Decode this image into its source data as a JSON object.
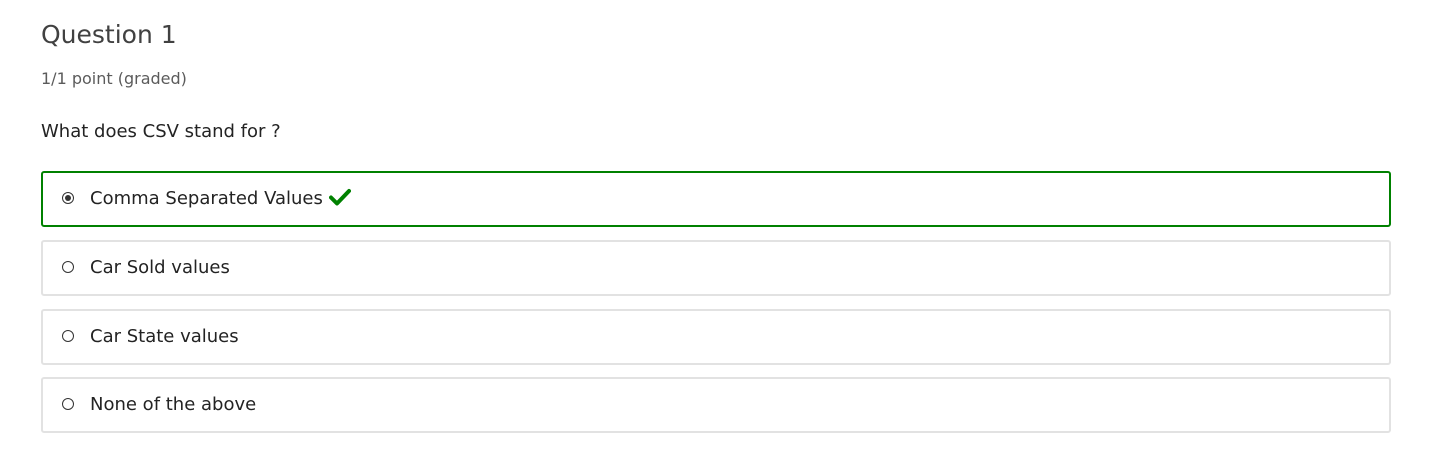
{
  "problem": {
    "title": "Question 1",
    "grade_status": "1/1 point (graded)",
    "prompt": "What does CSV stand for ?",
    "choices": [
      {
        "label": "Comma Separated Values",
        "selected": true,
        "correct": true
      },
      {
        "label": "Car Sold values",
        "selected": false,
        "correct": false
      },
      {
        "label": "Car State values",
        "selected": false,
        "correct": false
      },
      {
        "label": "None of the above",
        "selected": false,
        "correct": false
      }
    ]
  },
  "colors": {
    "correct": "#008100",
    "border": "#e2e2e2",
    "text": "#232323",
    "title": "#414141",
    "subtle": "#5b5b5b"
  },
  "icons": {
    "correct": "checkmark-icon",
    "choice_selected": "radio-checked-icon",
    "choice_unselected": "radio-unchecked-icon"
  }
}
